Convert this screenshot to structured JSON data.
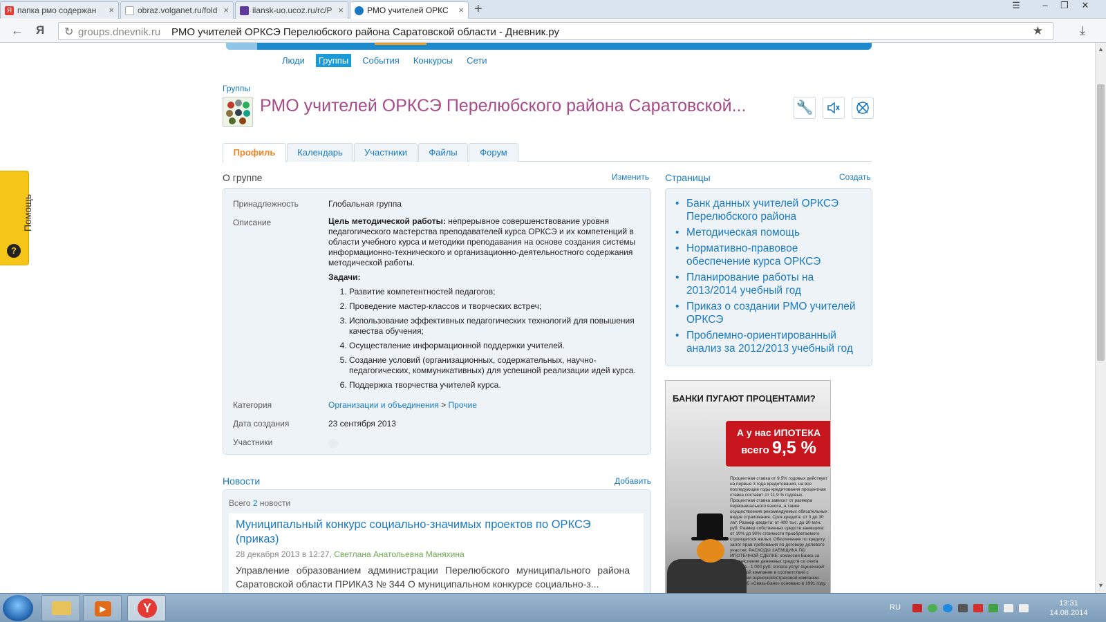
{
  "browser": {
    "tabs": [
      {
        "label": "папка рмо содержан",
        "favicon_color": "#e53935"
      },
      {
        "label": "obraz.volganet.ru/fold",
        "favicon_color": "#bbbbbb"
      },
      {
        "label": "ilansk-uo.ucoz.ru/rc/P",
        "favicon_color": "#5e3a9e"
      },
      {
        "label": "РМО учителей ОРКС",
        "favicon_color": "#1a7ac1"
      }
    ],
    "address_domain": "groups.dnevnik.ru",
    "address_title": "РМО учителей ОРКСЭ Перелюбского района Саратовской области - Дневник.ру"
  },
  "subnav": [
    "Люди",
    "Группы",
    "События",
    "Конкурсы",
    "Сети"
  ],
  "breadcrumb": "Группы",
  "group_title": "РМО учителей ОРКСЭ Перелюбского района Саратовской...",
  "profile_tabs": [
    "Профиль",
    "Календарь",
    "Участники",
    "Файлы",
    "Форум"
  ],
  "about": {
    "title": "О группе",
    "edit_link": "Изменить",
    "affiliation_label": "Принадлежность",
    "affiliation_value": "Глобальная группа",
    "description_label": "Описание",
    "goal_bold": "Цель методической работы:",
    "goal_text": " непрерывное совершенствование уровня педагогического мастерства преподавателей курса ОРКСЭ и их компетенций в области учебного курса и методики преподавания на основе создания системы информационно-технического и организационно-деятельностного содержания методической работы.",
    "tasks_title": "Задачи:",
    "tasks": [
      "Развитие компетентностей педагогов;",
      "Проведение мастер-классов и творческих встреч;",
      "Использование эффективных педагогических технологий для повышения качества обучения;",
      "Осуществление информационной поддержки учителей.",
      "Создание условий (организационных, содержательных, научно-педагогических, коммуникативных) для успешной реализации идей курса.",
      "Поддержка творчества учителей курса."
    ],
    "category_label": "Категория",
    "category_link1": "Организации и объединения",
    "category_sep": " > ",
    "category_link2": "Прочие",
    "created_label": "Дата создания",
    "created_value": "23 сентября 2013",
    "members_label": "Участники"
  },
  "pages": {
    "title": "Страницы",
    "create_link": "Создать",
    "items": [
      "Банк данных учителей ОРКСЭ Перелюбского района",
      "Методическая помощь",
      "Нормативно-правовое обеспечение курса ОРКСЭ",
      "Планирование работы на 2013/2014 учебный год",
      "Приказ о создании РМО учителей ОРКСЭ",
      "Проблемно-ориентированный анализ за 2012/2013 учебный год"
    ]
  },
  "ad": {
    "headline": "БАНКИ ПУГАЮТ ПРОЦЕНТАМИ?",
    "red_line1": "А у нас ИПОТЕКА",
    "red_line2_prefix": "всего ",
    "red_line2_value": "9,5 %",
    "fine_print": "Процентная ставка от 9,5% годовых действует на первые 3 года кредитования, на все последующие годы кредитования процентная ставка составит от 11,9 % годовых. Процентная ставка зависит от размера первоначального взноса, а также осуществления рекомендуемых обязательных видов страхования. Срок кредита: от 3 до 30 лет. Размер кредита: от 400 тыс. до 30 млн. руб. Размер собственных средств заемщика: от 10% до 90% стоимости приобретаемого строящегося жилья. Обеспечение по кредиту: залог прав требования по договору долевого участия; РАСХОДЫ ЗАЕМЩИКА ПО ИПОТЕЧНОЙ СДЕЛКЕ: комиссия Банка за перечисление денежных средств со счета клиента - 1 000 руб; оплата услуг оценочной/страховой компании в соответствии с тарифами оценочной/страховой компании. ОАО АКБ «Связь-Банк» основано в 1991 году."
  },
  "news": {
    "title": "Новости",
    "add_link": "Добавить",
    "count_prefix": "Всего ",
    "count_value": "2",
    "count_suffix": " новости",
    "item": {
      "headline": "Муниципальный конкурс социально-значимых проектов по ОРКСЭ (приказ)",
      "date": "28 декабря 2013 в 12:27, ",
      "author": "Светлана Анатольевна Маняхина",
      "text": "Управление образованием администрации Перелюбского муниципального района Саратовской области  ПРИКАЗ № 344  О муниципальном конкурсе социально-з..."
    }
  },
  "help_label": "Помощь",
  "taskbar": {
    "lang": "RU",
    "time": "13:31",
    "date": "14.08.2014"
  }
}
